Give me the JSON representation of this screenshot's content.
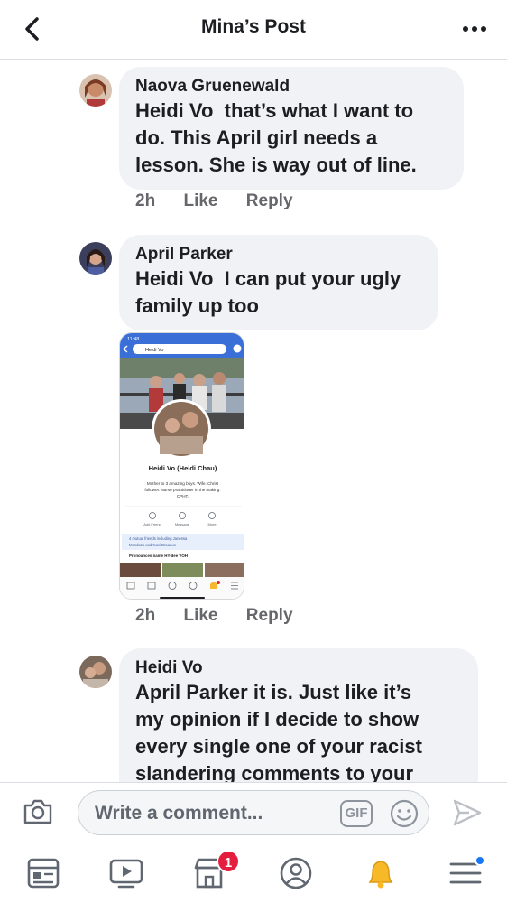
{
  "header": {
    "title": "Mina’s Post"
  },
  "comments": [
    {
      "author": "Naova Gruenewald",
      "mention": "Heidi Vo",
      "lines": [
        "that’s what I want to",
        "do. This April girl needs a",
        "lesson. She is way out of line."
      ],
      "time": "2h",
      "like": "Like",
      "reply": "Reply"
    },
    {
      "author": "April Parker",
      "mention": "Heidi Vo",
      "lines": [
        "I can put your ugly",
        "family up too"
      ],
      "time": "2h",
      "like": "Like",
      "reply": "Reply",
      "attachment": {
        "status_time": "11:48",
        "search_text": "Heidi Vo",
        "profile_name": "Heidi Vo (Heidi Chau)",
        "bio": [
          "Mother to 3 amazing boys. Wife. Christ",
          "follower. Nurse practitioner in the making.",
          "CPHT."
        ],
        "buttons": [
          "Add Friend",
          "Message",
          "More"
        ],
        "mutual": [
          "4 mutual friends including Janessa",
          "Mendoza and Noci Broadus"
        ],
        "pronounce": "Pronounces name HY-dee VOH"
      }
    },
    {
      "author": "Heidi Vo",
      "mention": "April Parker",
      "lines": [
        "it is. Just like it’s",
        "my opinion if I decide to show",
        "every single one of your racist",
        "slandering comments to your"
      ]
    }
  ],
  "composer": {
    "placeholder": "Write a comment...",
    "gif": "GIF"
  },
  "tabbar": {
    "marketplace_badge": "1"
  },
  "colors": {
    "accent": "#1877f2",
    "badge": "#e41e3f",
    "bubble": "#f0f2f5",
    "meta": "#65676b"
  }
}
